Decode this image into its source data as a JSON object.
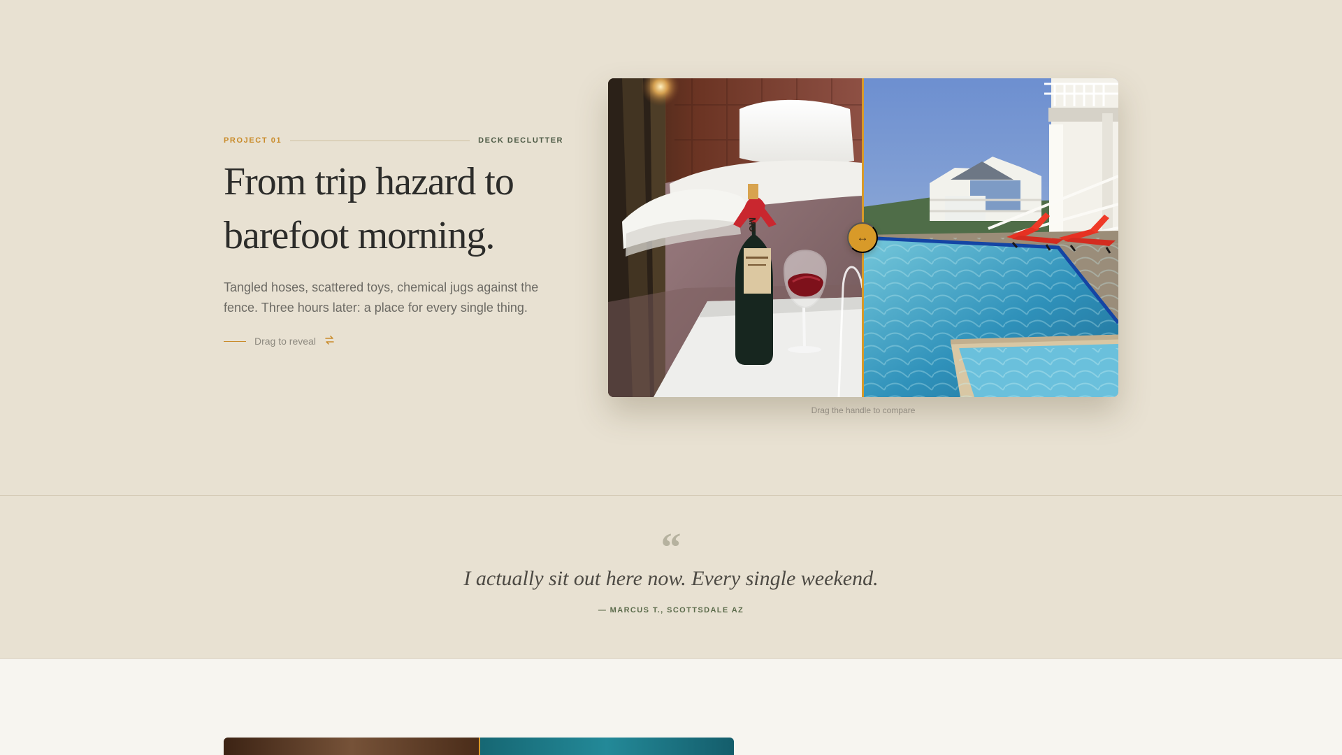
{
  "project": {
    "eyebrow": "PROJECT 01",
    "category": "DECK DECLUTTER",
    "title_line_1": "From trip hazard to",
    "title_line_2": "barefoot morning.",
    "description": "Tangled hoses, scattered toys, chemical jugs against the fence. Three hours later: a place for every single thing.",
    "reveal_label": "Drag to reveal",
    "reveal_icon": "swap-arrows-icon",
    "caption": "Drag the handle to compare",
    "handle_symbol": "↔",
    "before_photo": "hotel-bed-with-champagne-and-wine",
    "after_photo": "backyard-pool-with-red-loungers",
    "accent_color": "#d89a29"
  },
  "testimonial": {
    "quote_mark": "“",
    "quote": "I actually sit out here now. Every single weekend.",
    "author": "— MARCUS T., SCOTTSDALE AZ"
  },
  "next_project": {
    "before_photo": "wood-beam-ceiling",
    "after_photo": "blue-water"
  }
}
